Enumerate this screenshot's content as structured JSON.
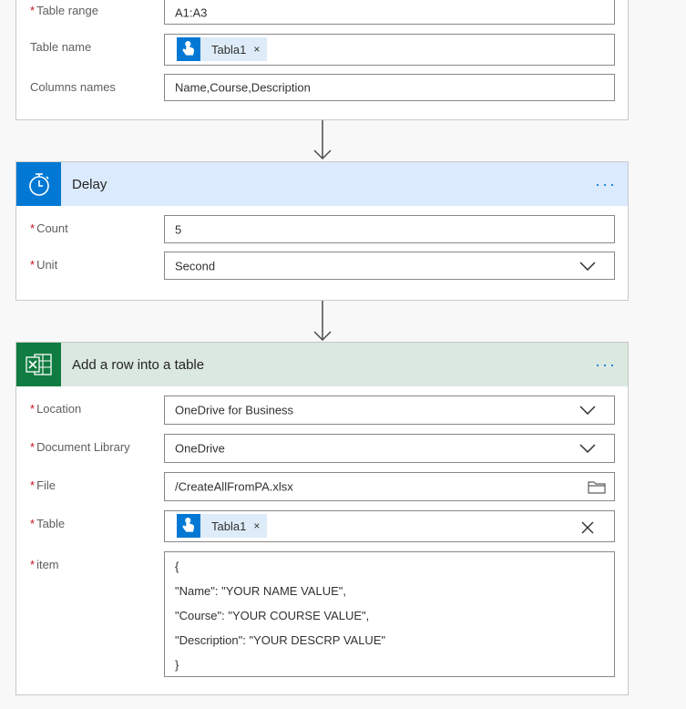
{
  "card1": {
    "rows": [
      {
        "label": "Table range",
        "required": "*",
        "value": "A1:A3"
      },
      {
        "label": "Table name",
        "token": "Tabla1",
        "token_remove": "×"
      },
      {
        "label": "Columns names",
        "value": "Name,Course,Description"
      }
    ]
  },
  "delay": {
    "title": "Delay",
    "more": "···",
    "header_color": "#dbeafd",
    "icon_color": "#0078d4",
    "count": {
      "label": "Count",
      "required": "*",
      "value": "5"
    },
    "unit": {
      "label": "Unit",
      "required": "*",
      "value": "Second"
    }
  },
  "addrow": {
    "title": "Add a row into a table",
    "more": "···",
    "header_color": "#dae8df",
    "icon_color": "#107c41",
    "location": {
      "label": "Location",
      "required": "*",
      "value": "OneDrive for Business"
    },
    "library": {
      "label": "Document Library",
      "required": "*",
      "value": "OneDrive"
    },
    "file": {
      "label": "File",
      "required": "*",
      "value": "/CreateAllFromPA.xlsx"
    },
    "table": {
      "label": "Table",
      "required": "*",
      "token": "Tabla1",
      "token_remove": "×"
    },
    "item": {
      "label": "item",
      "required": "*",
      "lines": [
        "{",
        "\"Name\": \"YOUR NAME VALUE\",",
        "\"Course\": \"YOUR COURSE VALUE\",",
        "\"Description\": \"YOUR DESCRP VALUE\"",
        "}"
      ]
    }
  }
}
